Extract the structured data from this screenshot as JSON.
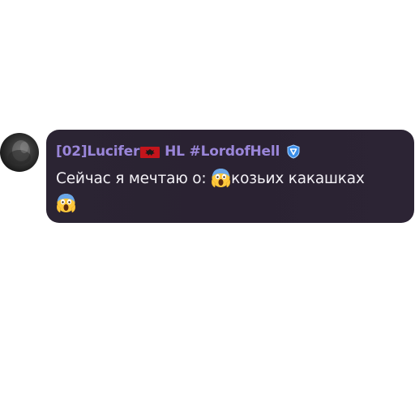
{
  "sender": {
    "name_prefix": "[02]Lucifer",
    "flag_icon": "albania-flag-icon",
    "name_suffix": "HL #LordofHell",
    "badge_icon": "shield-v-badge-icon",
    "name_color": "#9a86d9"
  },
  "message": {
    "text_before": "Сейчас я мечтаю о: ",
    "emoji_icon": "screaming-face-emoji-icon",
    "text_after": "козьих какашках"
  },
  "colors": {
    "bubble_bg": "#2b2433",
    "text": "#f3f1f6",
    "badge_blue": "#3b8ee8"
  }
}
